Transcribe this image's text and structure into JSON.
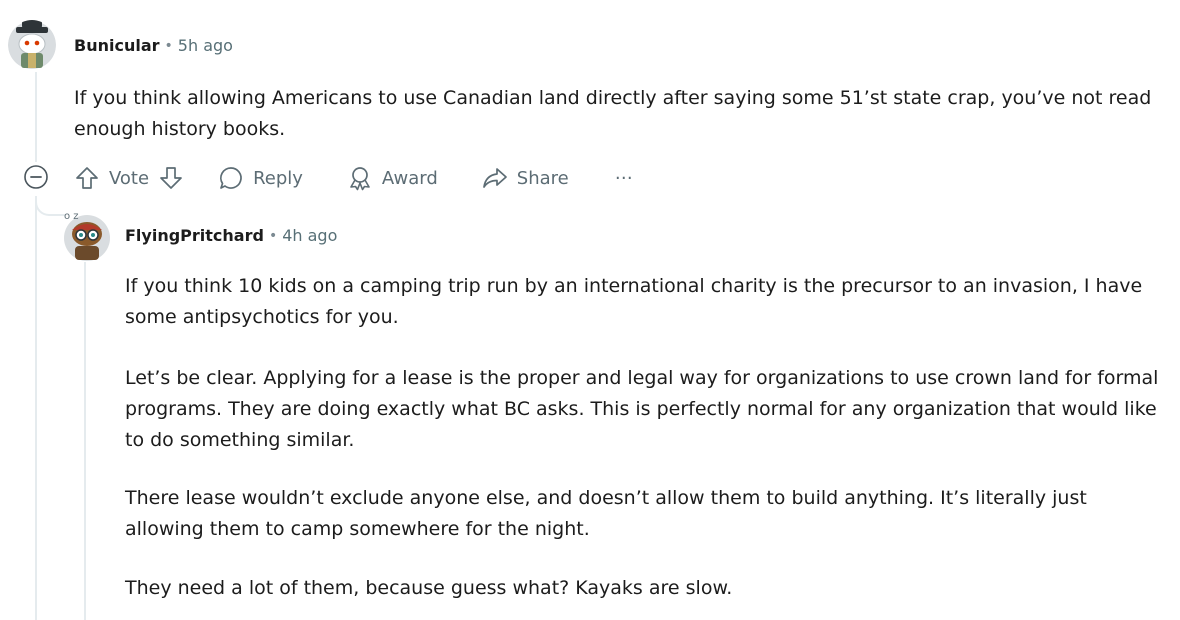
{
  "comments": [
    {
      "author": "Bunicular",
      "time": "5h ago",
      "paragraphs": [
        "If you think allowing Americans to use Canadian land directly after saying some 51’st state crap, you’ve not read enough history books."
      ],
      "actions": {
        "vote": "Vote",
        "reply": "Reply",
        "award": "Award",
        "share": "Share",
        "more": "…"
      }
    },
    {
      "author": "FlyingPritchard",
      "time": "4h ago",
      "paragraphs": [
        "If you think 10 kids on a camping trip run by an international charity is the precursor to an invasion, I have some antipsychotics for you.",
        "Let’s be clear. Applying for a lease is the proper and legal way for organizations to use crown land for formal programs. They are doing exactly what BC asks. This is perfectly normal for any organization that would like to do something similar.",
        "There lease wouldn’t exclude anyone else, and doesn’t allow them to build anything. It’s literally just allowing them to camp somewhere for the night.",
        "They need a lot of them, because guess what? Kayaks are slow."
      ]
    }
  ],
  "icons": {
    "collapse": "minus-circle-icon",
    "upvote": "arrow-up-icon",
    "downvote": "arrow-down-icon",
    "reply": "speech-bubble-icon",
    "award": "award-ribbon-icon",
    "share": "share-arrow-icon"
  },
  "colors": {
    "text": "#1c1c1c",
    "meta": "#576f76",
    "icon": "#5c6c74",
    "thread_line": "#e5ebee"
  }
}
